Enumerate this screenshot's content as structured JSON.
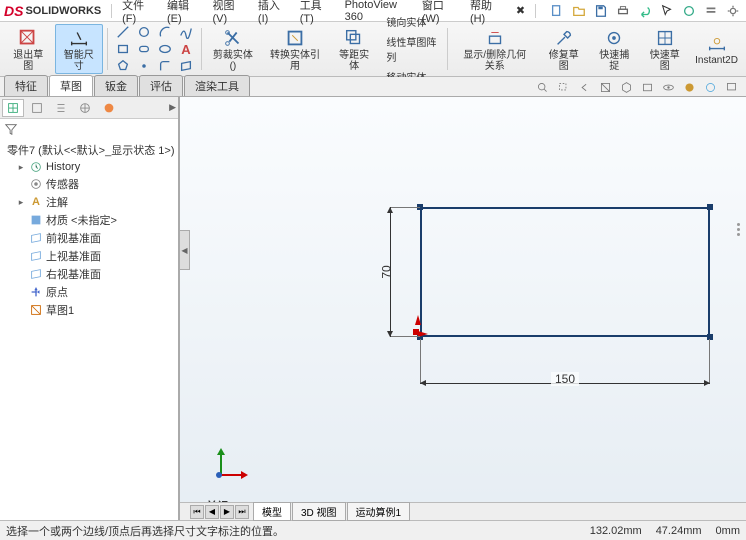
{
  "app": {
    "logo": "SOLIDWORKS"
  },
  "menu": [
    {
      "label": "文件(F)"
    },
    {
      "label": "编辑(E)"
    },
    {
      "label": "视图(V)"
    },
    {
      "label": "插入(I)"
    },
    {
      "label": "工具(T)"
    },
    {
      "label": "PhotoView 360"
    },
    {
      "label": "窗口(W)"
    },
    {
      "label": "帮助(H)"
    }
  ],
  "ribbon": {
    "exit": "退出草图",
    "smart": "智能尺寸",
    "cut": "剪裁实体()",
    "convert": "转换实体引用",
    "offset": "等距实体",
    "mirror": "镜向实体",
    "pattern": "线性草图阵列",
    "move": "移动实体",
    "show": "显示/删除几何关系",
    "repair": "修复草图",
    "quick": "快速捕捉",
    "rapid": "快速草图",
    "instant": "Instant2D"
  },
  "tabs": [
    "特征",
    "草图",
    "钣金",
    "评估",
    "渲染工具"
  ],
  "active_tab": 1,
  "tree": {
    "root": "零件7  (默认<<默认>_显示状态 1>)",
    "items": [
      {
        "label": "History",
        "ico": "#5a8"
      },
      {
        "label": "传感器",
        "ico": "#888"
      },
      {
        "label": "注解",
        "ico": "#c93"
      },
      {
        "label": "材质 <未指定>",
        "ico": "#7ad"
      },
      {
        "label": "前视基准面",
        "ico": "#7ad"
      },
      {
        "label": "上视基准面",
        "ico": "#7ad"
      },
      {
        "label": "右视基准面",
        "ico": "#7ad"
      },
      {
        "label": "原点",
        "ico": "#46c"
      },
      {
        "label": "草图1",
        "ico": "#c60"
      }
    ]
  },
  "dims": {
    "w": "150",
    "h": "70"
  },
  "view_label": "*前视",
  "bottom_tabs": [
    "模型",
    "3D 视图",
    "运动算例1"
  ],
  "status": {
    "msg": "选择一个或两个边线/顶点后再选择尺寸文字标注的位置。",
    "x": "132.02mm",
    "y": "47.24mm",
    "z": "0mm"
  }
}
